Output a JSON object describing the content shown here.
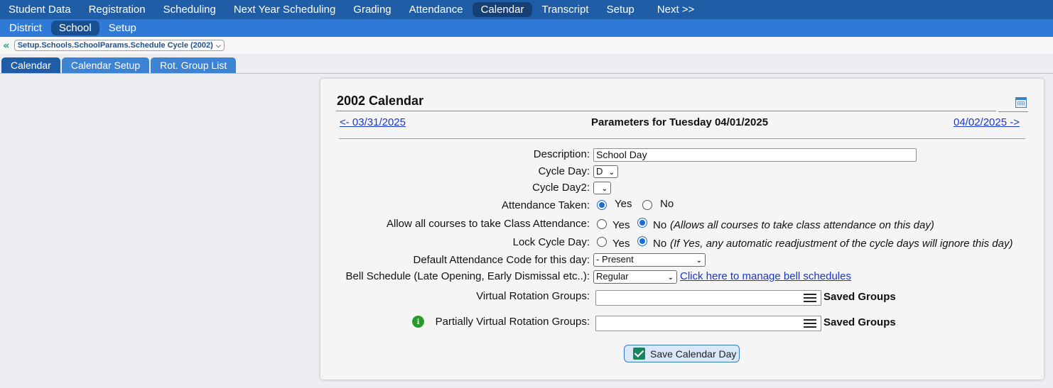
{
  "topnav": [
    "Student Data",
    "Registration",
    "Scheduling",
    "Next Year Scheduling",
    "Grading",
    "Attendance",
    "Calendar",
    "Transcript",
    "Setup",
    "Next >>"
  ],
  "subnav": [
    "District",
    "School",
    "Setup"
  ],
  "breadcrumb": {
    "back": "«",
    "path": "Setup.Schools.SchoolParams.Schedule Cycle (2002)"
  },
  "tabs": [
    "Calendar",
    "Calendar Setup",
    "Rot. Group List"
  ],
  "panel": {
    "title": "2002 Calendar",
    "prev_date": "<- 03/31/2025",
    "header": "Parameters for Tuesday 04/01/2025",
    "next_date": "04/02/2025 ->"
  },
  "form": {
    "description_label": "Description:",
    "description_value": "School Day",
    "cycle_day_label": "Cycle Day:",
    "cycle_day_value": "D",
    "cycle_day2_label": "Cycle Day2:",
    "cycle_day2_value": "",
    "attendance_taken_label": "Attendance Taken:",
    "allow_all_label": "Allow all courses to take Class Attendance:",
    "allow_all_note": "(Allows all courses to take class attendance on this day)",
    "lock_cycle_label": "Lock Cycle Day:",
    "lock_cycle_note": "(If Yes, any automatic readjustment of the cycle days will ignore this day)",
    "yes": "Yes",
    "no": "No",
    "default_code_label": "Default Attendance Code for this day:",
    "default_code_value": "- Present",
    "bell_label": "Bell Schedule (Late Opening, Early Dismissal etc..):",
    "bell_value": "Regular",
    "bell_link": "Click here to manage bell schedules",
    "virtual_label": "Virtual Rotation Groups:",
    "partial_label": "Partially Virtual Rotation Groups:",
    "saved_groups": "Saved Groups",
    "save_button": "Save Calendar Day"
  },
  "state": {
    "active_topnav": "Calendar",
    "active_subnav": "School",
    "active_tab": "Calendar",
    "attendance_taken": "Yes",
    "allow_all": "No",
    "lock_cycle": "No"
  },
  "colors": {
    "topnav": "#1f5da7",
    "subnav": "#2f7ad6",
    "link": "#1a37c9",
    "radio_selected": "#1a6dd1",
    "info_icon": "#2a9a2a",
    "save_check": "#18865c"
  }
}
